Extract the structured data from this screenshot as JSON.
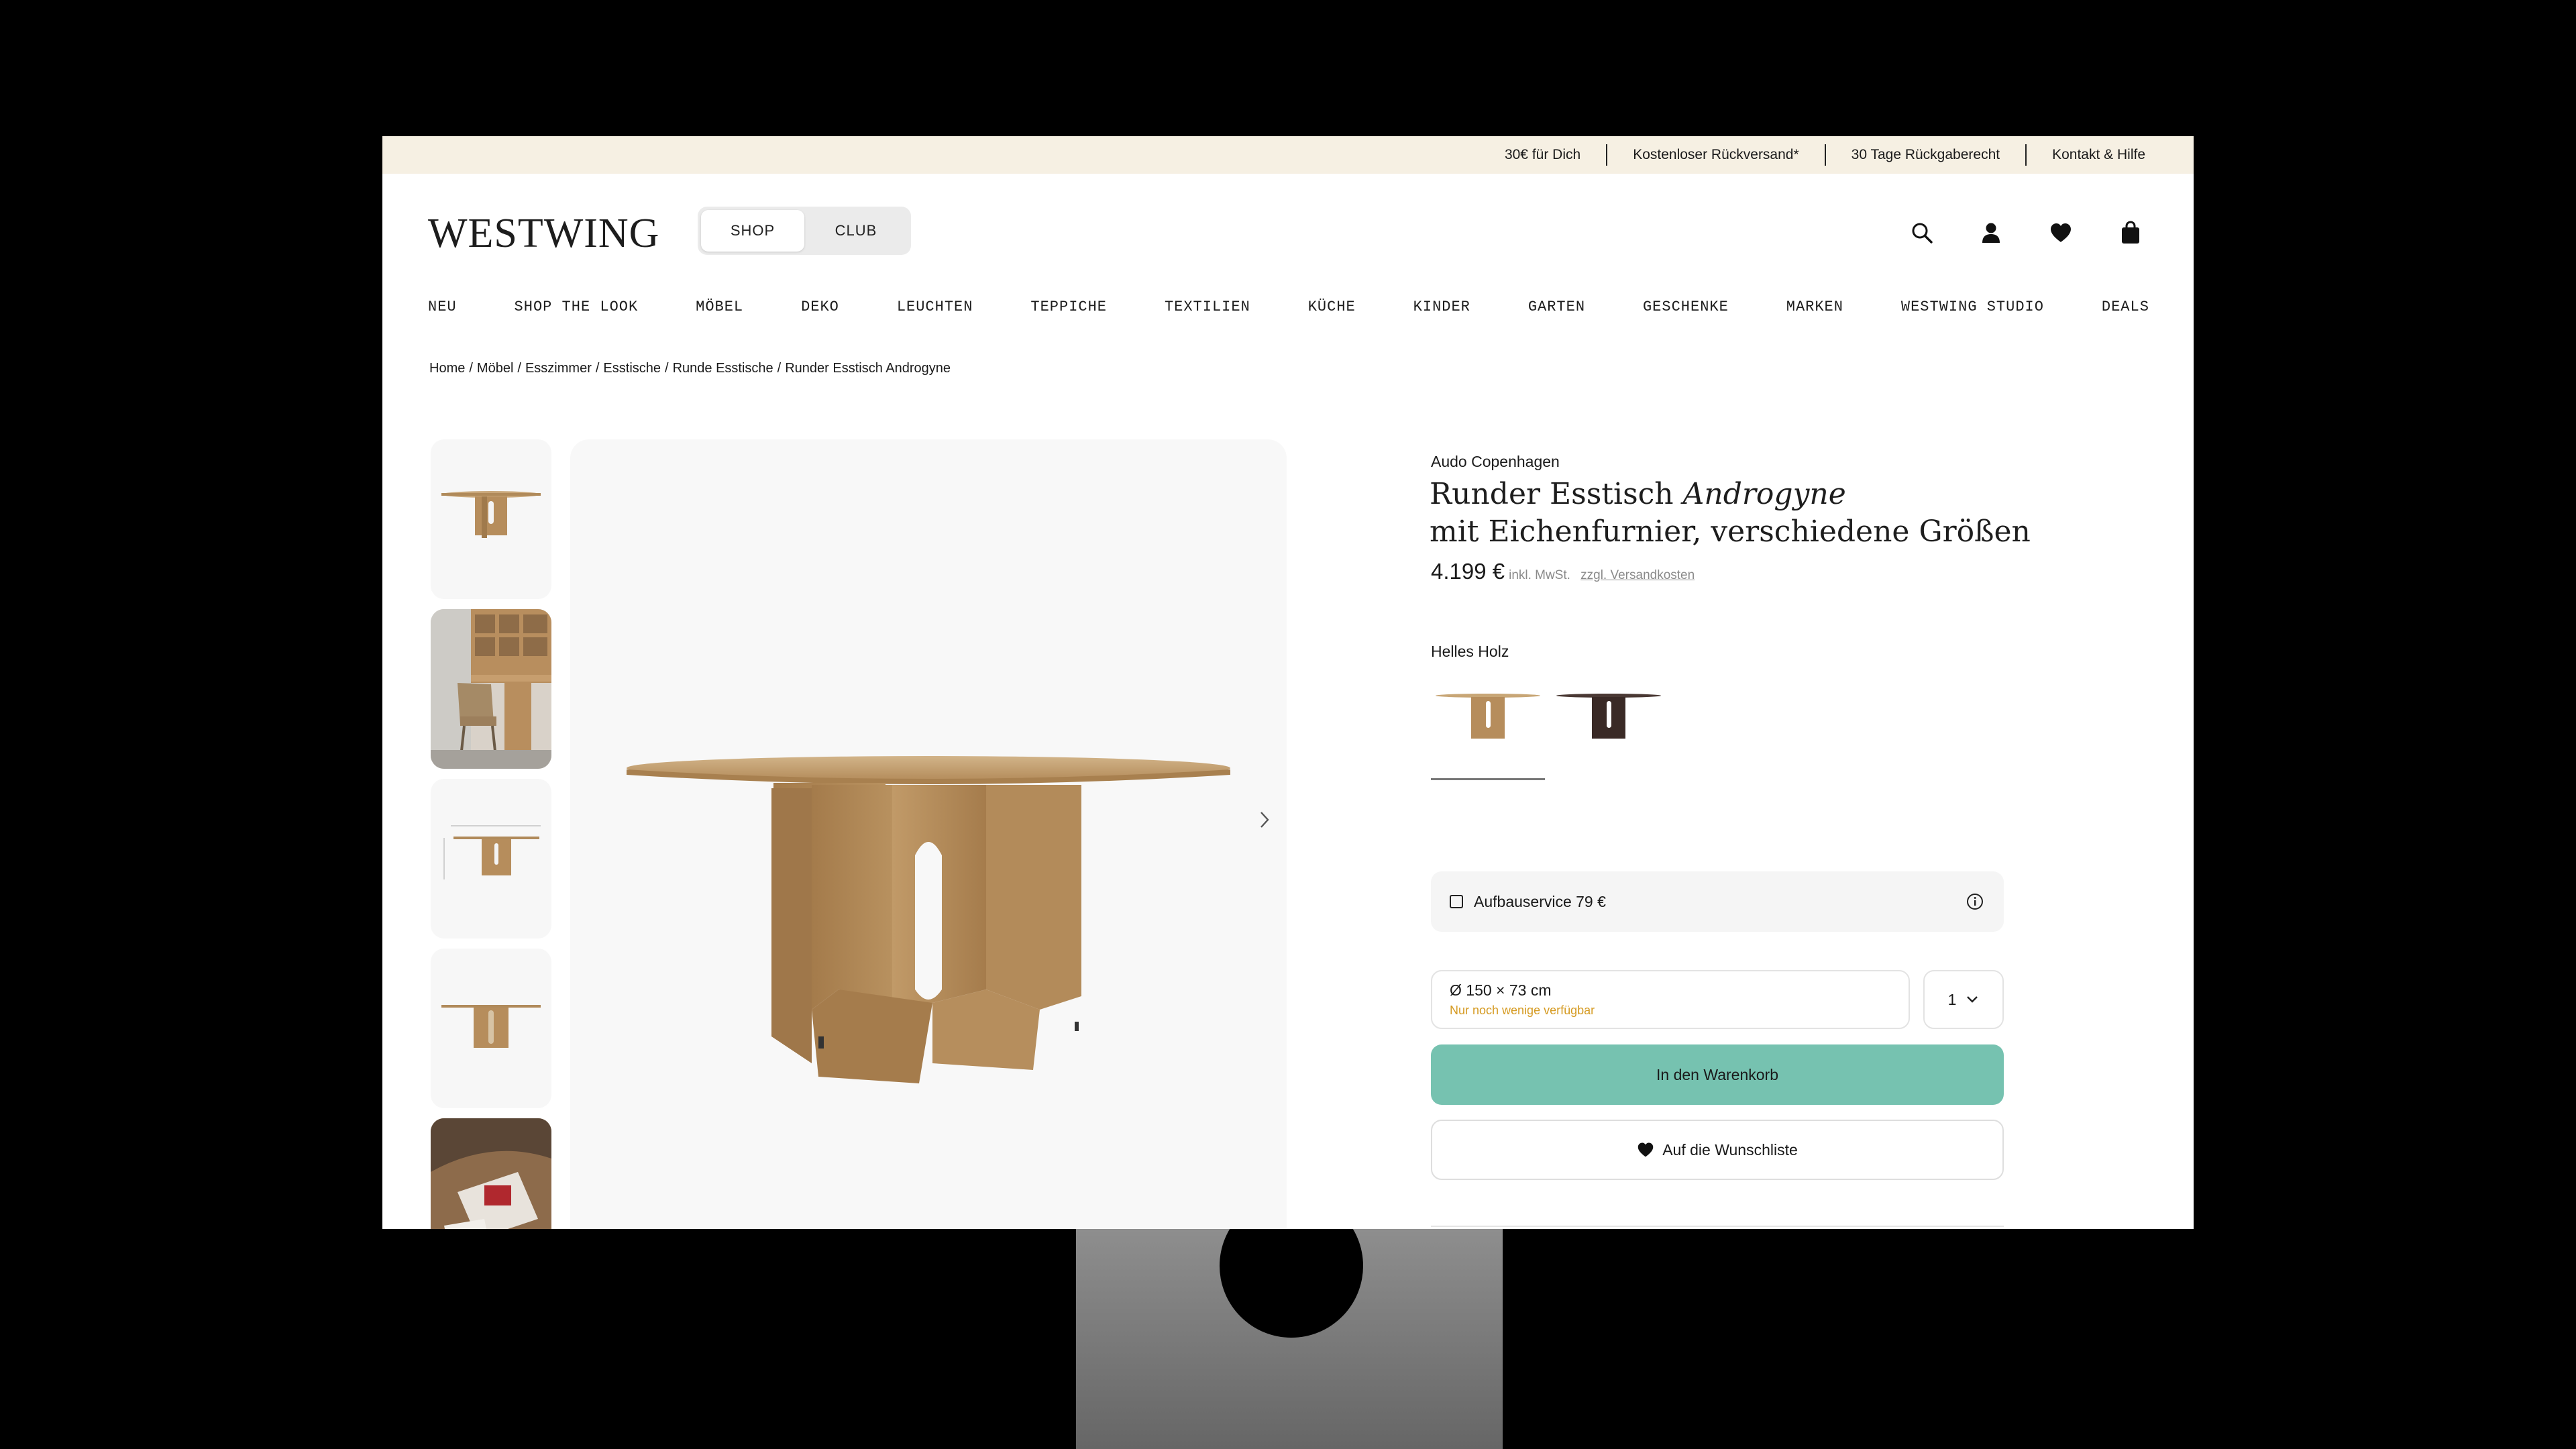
{
  "utility_bar": {
    "links": [
      "30€ für Dich",
      "Kostenloser Rückversand*",
      "30 Tage Rückgaberecht",
      "Kontakt & Hilfe"
    ]
  },
  "header": {
    "logo": "WESTWING",
    "modes": [
      "SHOP",
      "CLUB"
    ],
    "active_mode": "SHOP",
    "icons": [
      "search-icon",
      "account-icon",
      "wishlist-heart-icon",
      "shopping-bag-icon"
    ]
  },
  "nav": {
    "items": [
      "NEU",
      "SHOP THE LOOK",
      "MÖBEL",
      "DEKO",
      "LEUCHTEN",
      "TEPPICHE",
      "TEXTILIEN",
      "KÜCHE",
      "KINDER",
      "GARTEN",
      "GESCHENKE",
      "MARKEN",
      "WESTWING STUDIO",
      "DEALS"
    ]
  },
  "breadcrumb": [
    "Home",
    "Möbel",
    "Esszimmer",
    "Esstische",
    "Runde Esstische",
    "Runder Esstisch Androgyne"
  ],
  "product": {
    "brand": "Audo Copenhagen",
    "title_prefix": "Runder Esstisch ",
    "title_name": "Androgyne",
    "title_line2": "mit Eichenfurnier, verschiedene Größen",
    "price": "4.199 €",
    "tax_note": "inkl. MwSt.",
    "shipping_link": "zzgl. Versandkosten",
    "color_label": "Helles Holz",
    "swatches": [
      "light-oak",
      "dark-wood"
    ],
    "assembly_label": "Aufbauservice 79 €",
    "size_value": "Ø 150 × 73 cm",
    "stock_note": "Nur noch wenige verfügbar",
    "quantity": "1",
    "cart_label": "In den Warenkorb",
    "wishlist_label": "Auf die Wunschliste"
  },
  "colors": {
    "utility_bg": "#f6f0e3",
    "cart_button": "#76c2b0",
    "stock_warning": "#d59a21",
    "wood_light": "#c09a68",
    "wood_dark": "#3a2a26"
  }
}
